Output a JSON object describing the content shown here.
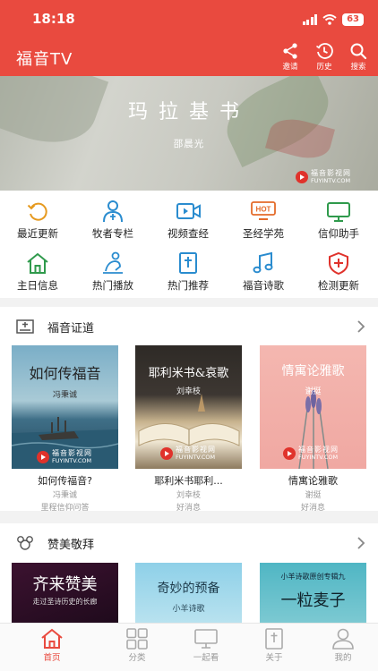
{
  "status_bar": {
    "time": "18:18",
    "battery": "63"
  },
  "header": {
    "app_title": "福音TV",
    "actions": [
      {
        "label": "邀请",
        "icon": "share-icon"
      },
      {
        "label": "历史",
        "icon": "history-icon"
      },
      {
        "label": "搜索",
        "icon": "search-icon"
      }
    ]
  },
  "banner": {
    "title": "玛拉基书",
    "subtitle": "邵晨光",
    "watermark_cn": "福音影视网",
    "watermark_en": "FUYINTV.COM"
  },
  "menu": {
    "items": [
      {
        "label": "最近更新",
        "icon": "refresh-icon"
      },
      {
        "label": "牧者专栏",
        "icon": "pastor-icon"
      },
      {
        "label": "视频查经",
        "icon": "video-icon"
      },
      {
        "label": "圣经学苑",
        "icon": "hot-badge-icon",
        "badge": "HOT"
      },
      {
        "label": "信仰助手",
        "icon": "monitor-icon"
      },
      {
        "label": "主日信息",
        "icon": "home-icon"
      },
      {
        "label": "热门播放",
        "icon": "prayer-icon"
      },
      {
        "label": "热门推荐",
        "icon": "bible-icon"
      },
      {
        "label": "福音诗歌",
        "icon": "music-note-icon"
      },
      {
        "label": "检测更新",
        "icon": "shield-icon"
      }
    ]
  },
  "sections": [
    {
      "title": "福音证道",
      "cards": [
        {
          "cover_title": "如何传福音",
          "cover_sub": "冯秉诚",
          "title": "如何传福音?",
          "line1": "冯秉诚",
          "line2": "里程信仰问答"
        },
        {
          "cover_title": "耶利米书&哀歌",
          "cover_sub": "刘幸枝",
          "title": "耶利米书耶利...",
          "line1": "刘幸枝",
          "line2": "好消息"
        },
        {
          "cover_title": "情寓论雅歌",
          "cover_sub": "谢挺",
          "title": "情寓论雅歌",
          "line1": "谢挺",
          "line2": "好消息"
        }
      ]
    },
    {
      "title": "赞美敬拜",
      "cards": [
        {
          "cover_title": "齐来赞美",
          "cover_sub": "走过圣诗历史的长廊"
        },
        {
          "cover_title": "奇妙的预备",
          "cover_sub": "小羊诗歌"
        },
        {
          "cover_title": "一粒麦子",
          "cover_sub": "小羊诗歌原创专辑九"
        }
      ]
    }
  ],
  "tabbar": {
    "tabs": [
      {
        "label": "首页",
        "active": true
      },
      {
        "label": "分类"
      },
      {
        "label": "一起看"
      },
      {
        "label": "关于"
      },
      {
        "label": "我的"
      }
    ]
  },
  "colors": {
    "brand": "#e94a3f",
    "icon_blue": "#2a8ccf",
    "icon_green": "#2f9a4c"
  }
}
